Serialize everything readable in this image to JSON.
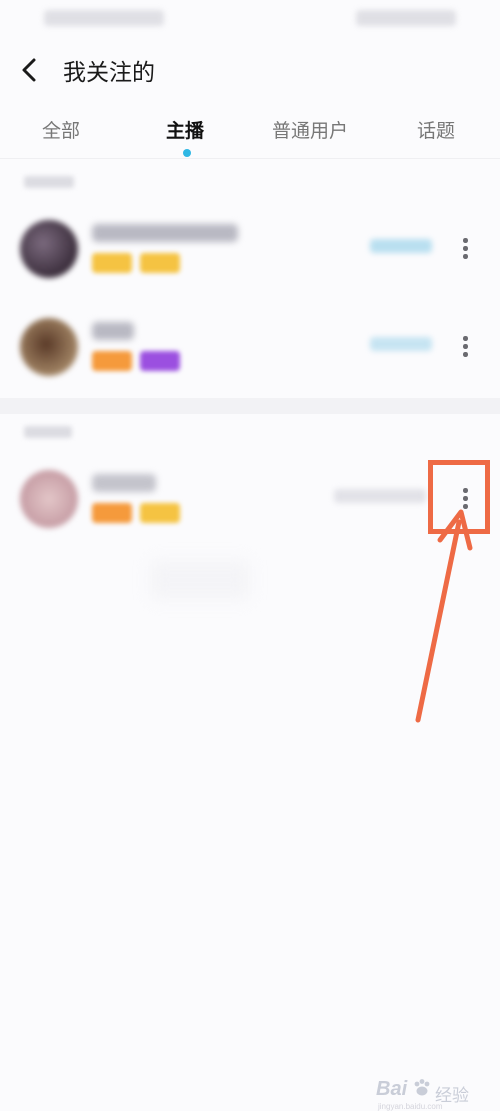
{
  "header": {
    "title": "我关注的",
    "back_icon": "chevron-left-icon"
  },
  "tabs": [
    {
      "label": "全部",
      "active": false
    },
    {
      "label": "主播",
      "active": true
    },
    {
      "label": "普通用户",
      "active": false
    },
    {
      "label": "话题",
      "active": false
    }
  ],
  "colors": {
    "accent": "#2fb7e4",
    "highlight": "#ee6a45",
    "tag_yellow": "#f5c342",
    "tag_orange": "#f59a3c",
    "tag_purple": "#9b4fe0"
  },
  "rows": [
    {
      "more_icon": "more-vertical-icon"
    },
    {
      "more_icon": "more-vertical-icon"
    },
    {
      "more_icon": "more-vertical-icon"
    }
  ],
  "watermark": {
    "brand": "Bai",
    "suffix": "经验",
    "url": "jingyan.baidu.com"
  }
}
